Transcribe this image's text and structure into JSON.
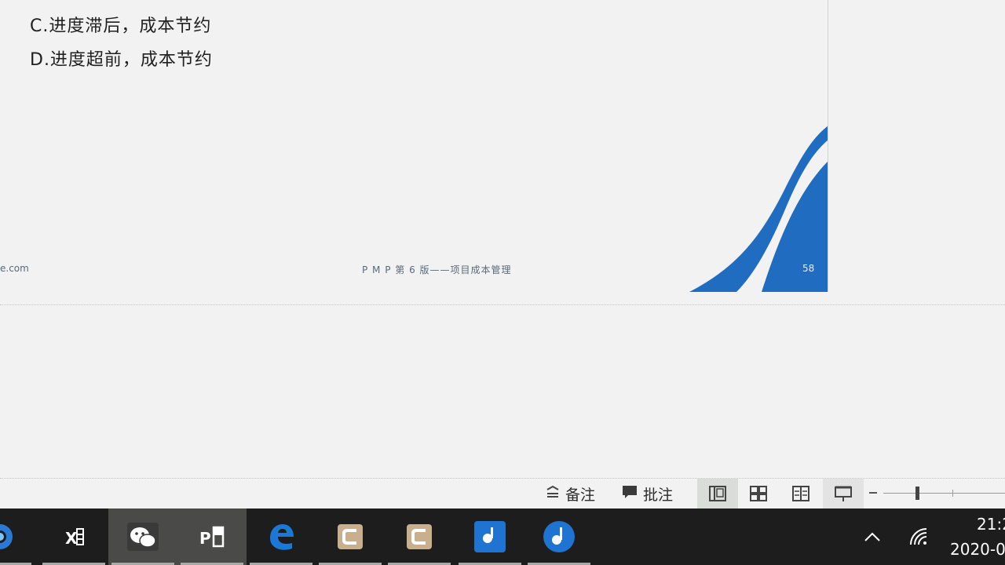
{
  "slide": {
    "option_c": "C.进度滞后，成本节约",
    "option_d": "D.进度超前，成本节约",
    "footer_url": "e.com",
    "footer_title": "P M P 第 6 版——项目成本管理",
    "page_number": "58",
    "accent_color": "#1f6cc0"
  },
  "statusbar": {
    "notes_label": "备注",
    "comments_label": "批注",
    "views": [
      "normal-view",
      "slide-sorter-view",
      "reading-view",
      "slideshow-view"
    ]
  },
  "taskbar": {
    "apps": [
      {
        "name": "browser-icon",
        "active": false
      },
      {
        "name": "excel-icon",
        "active": false
      },
      {
        "name": "wechat-icon",
        "active": true
      },
      {
        "name": "powerpoint-icon",
        "active": true
      },
      {
        "name": "edge-icon",
        "active": false
      },
      {
        "name": "app-c-icon",
        "active": false
      },
      {
        "name": "app-c-icon",
        "active": false
      },
      {
        "name": "music-app-icon",
        "active": false
      },
      {
        "name": "music-app-icon",
        "active": false
      }
    ],
    "time": "21:2",
    "date": "2020-0"
  }
}
